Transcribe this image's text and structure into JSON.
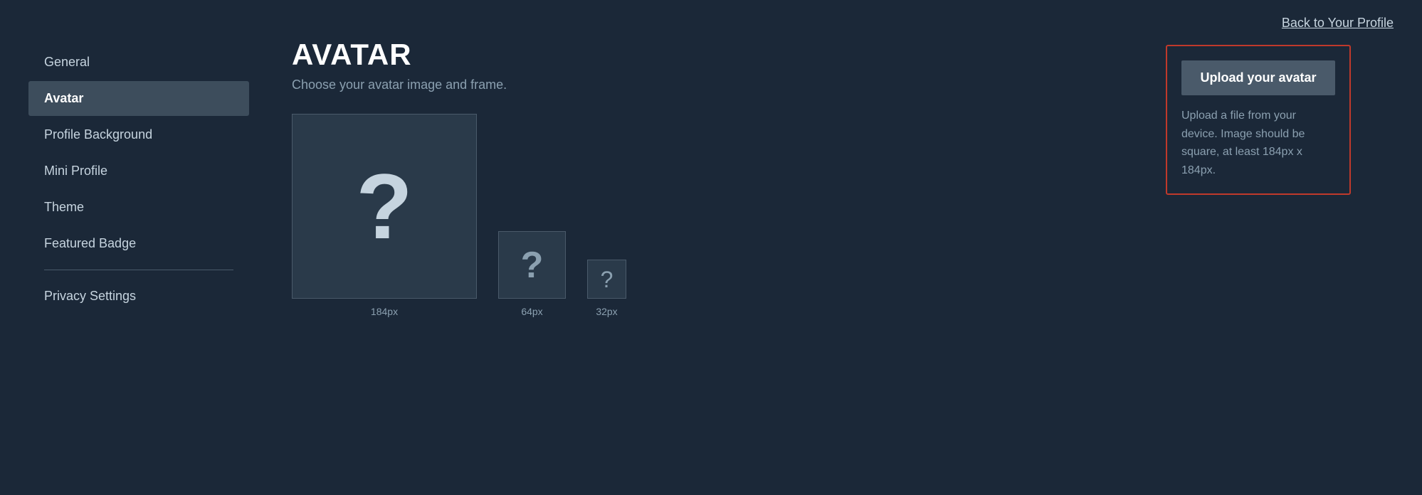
{
  "topbar": {
    "back_link": "Back to Your Profile"
  },
  "sidebar": {
    "items": [
      {
        "id": "general",
        "label": "General",
        "active": false,
        "has_divider_before": false
      },
      {
        "id": "avatar",
        "label": "Avatar",
        "active": true,
        "has_divider_before": false
      },
      {
        "id": "profile-background",
        "label": "Profile Background",
        "active": false,
        "has_divider_before": false
      },
      {
        "id": "mini-profile",
        "label": "Mini Profile",
        "active": false,
        "has_divider_before": false
      },
      {
        "id": "theme",
        "label": "Theme",
        "active": false,
        "has_divider_before": false
      },
      {
        "id": "featured-badge",
        "label": "Featured Badge",
        "active": false,
        "has_divider_before": false
      },
      {
        "id": "privacy-settings",
        "label": "Privacy Settings",
        "active": false,
        "has_divider_before": true
      }
    ]
  },
  "content": {
    "title": "AVATAR",
    "subtitle": "Choose your avatar image and frame.",
    "previews": [
      {
        "size": "184px",
        "size_label": "184px"
      },
      {
        "size": "64px",
        "size_label": "64px"
      },
      {
        "size": "32px",
        "size_label": "32px"
      }
    ]
  },
  "upload": {
    "button_label": "Upload your avatar",
    "description": "Upload a file from your device. Image should be square, at least 184px x 184px."
  }
}
